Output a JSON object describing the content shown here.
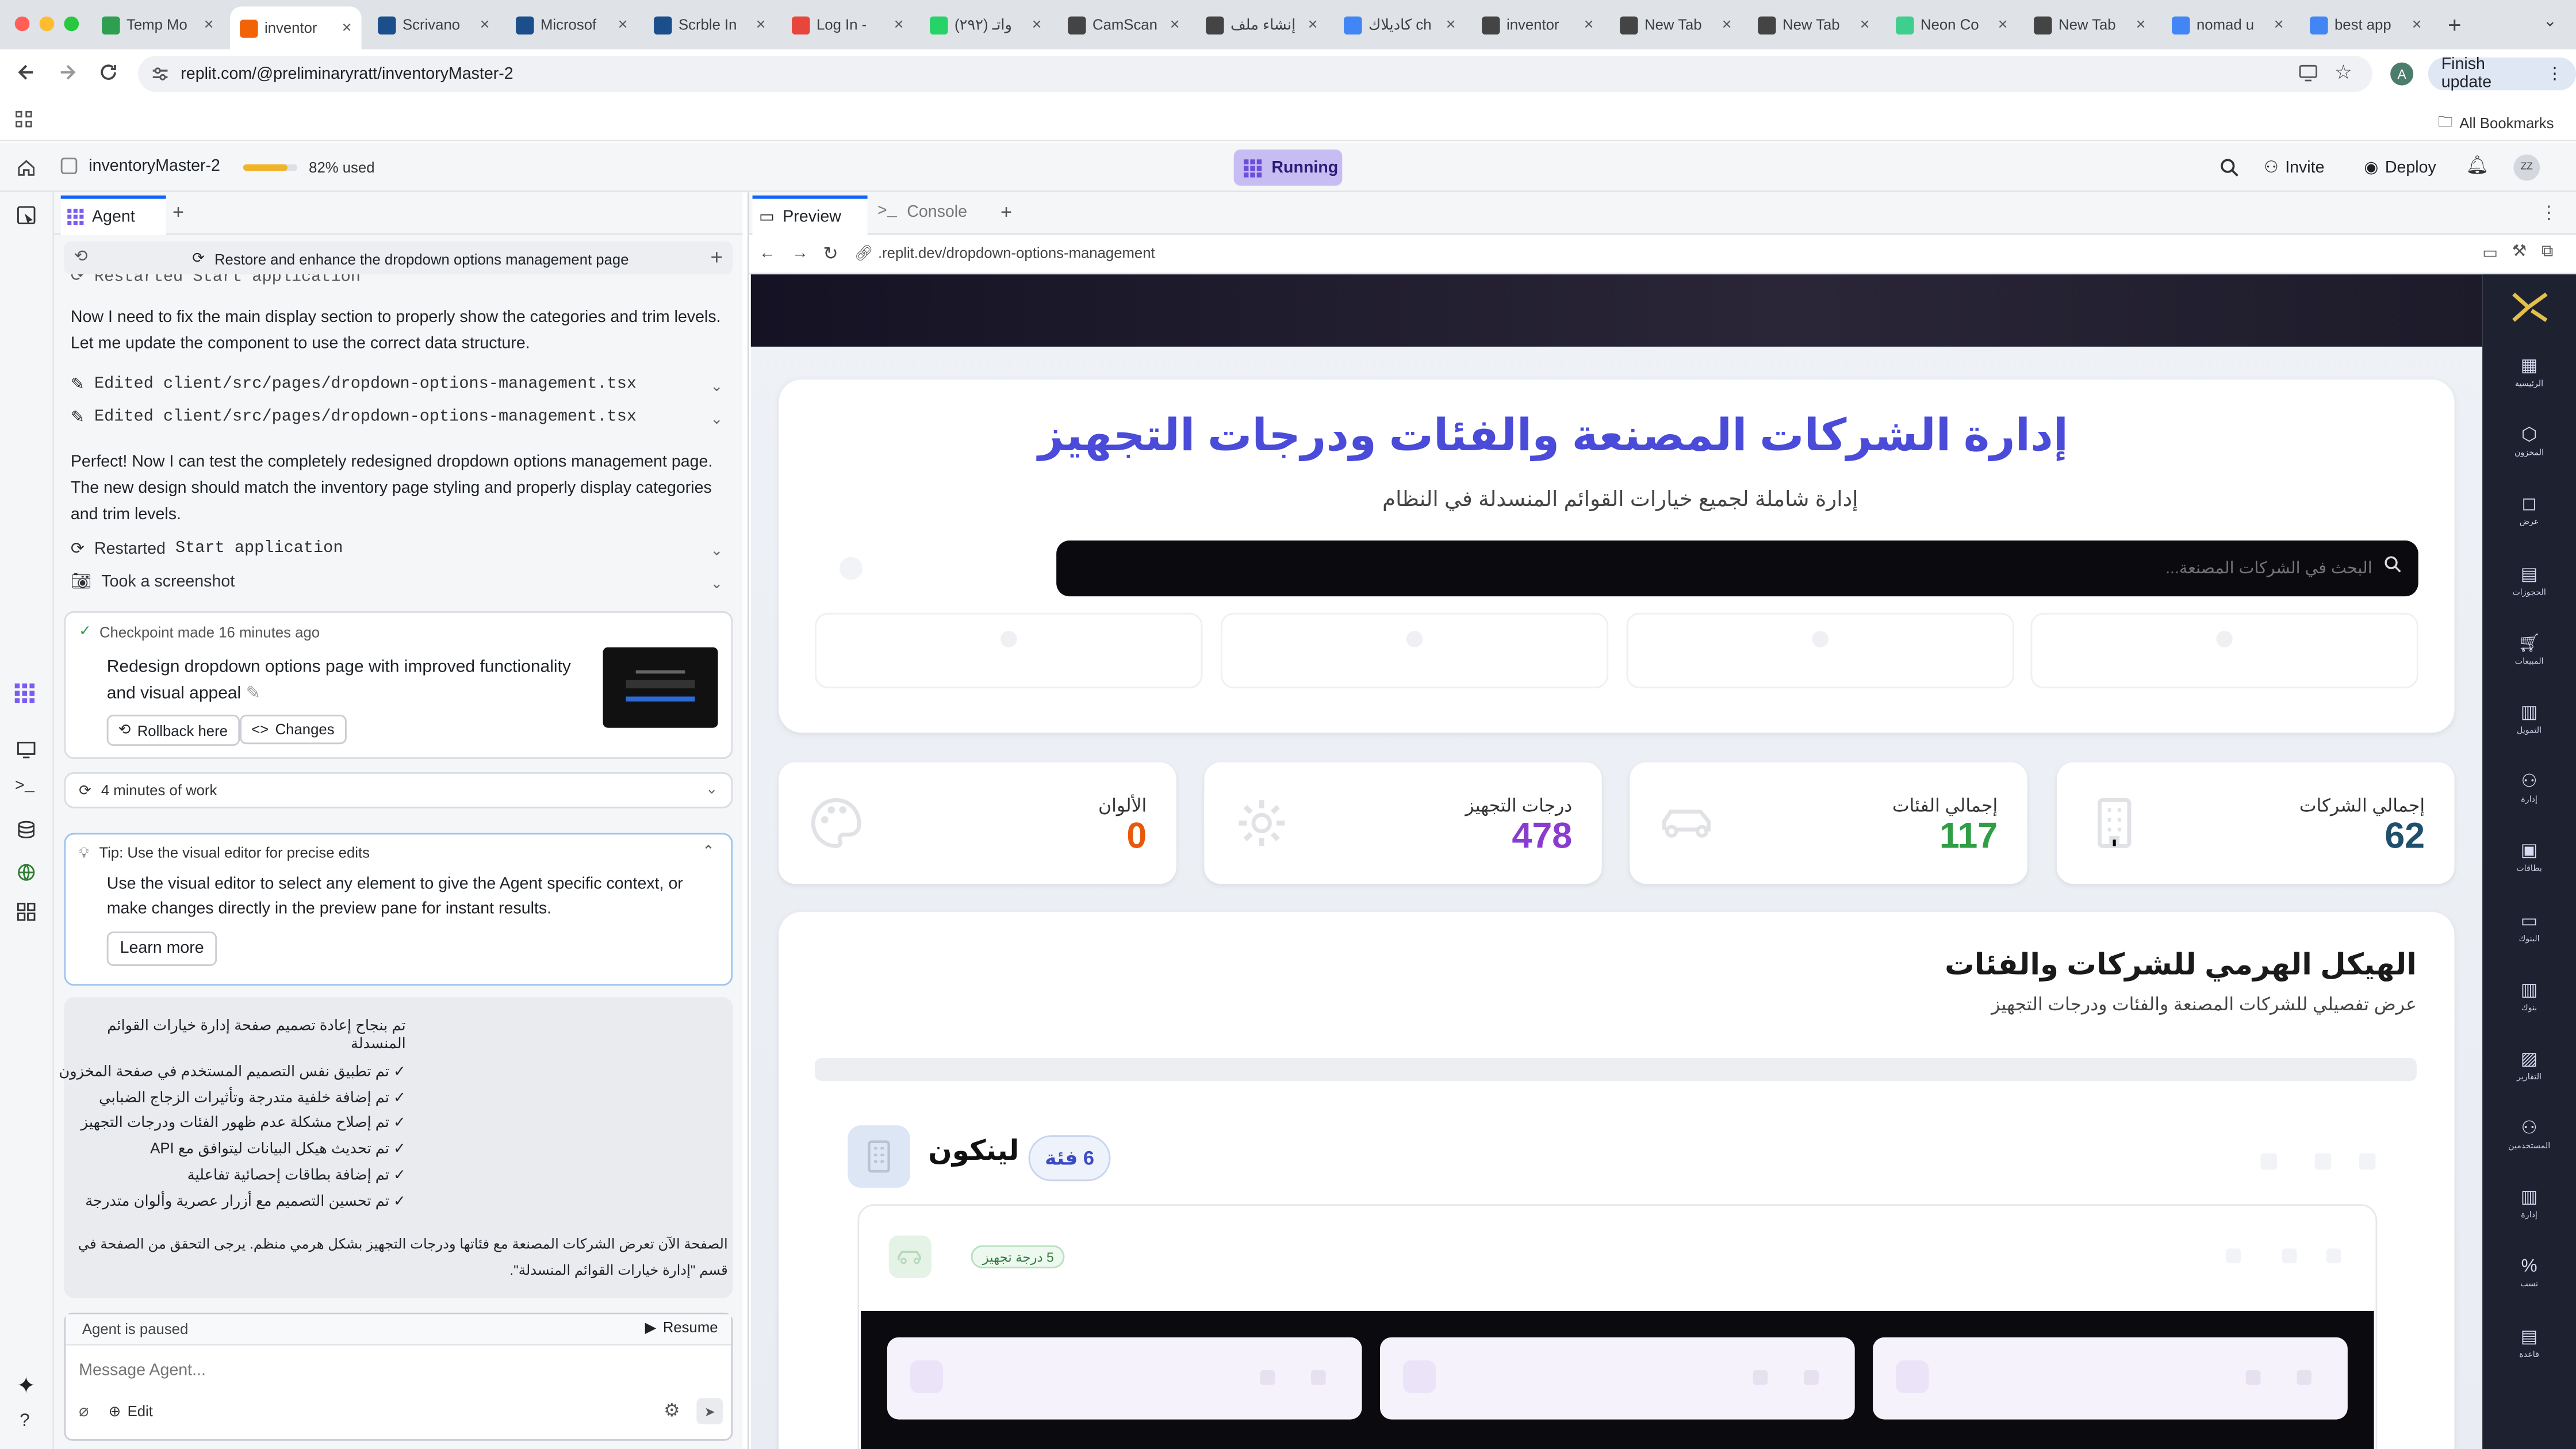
{
  "browser": {
    "tabs": [
      {
        "title": "Temp Mo",
        "color": "#2e9e4f"
      },
      {
        "title": "inventor",
        "color": "#f26207",
        "active": true
      },
      {
        "title": "Scrivano",
        "color": "#1a4f8b"
      },
      {
        "title": "Microsof",
        "color": "#1a4f8b"
      },
      {
        "title": "Scrble In",
        "color": "#1a4f8b"
      },
      {
        "title": "Log In - ",
        "color": "#e8453c"
      },
      {
        "title": "(۲۹۲) واتـ",
        "color": "#25d366"
      },
      {
        "title": "CamScan",
        "color": "#444"
      },
      {
        "title": "إنشاء ملف",
        "color": "#444"
      },
      {
        "title": "كاديلاك ch",
        "color": "#4285f4"
      },
      {
        "title": "inventor",
        "color": "#444"
      },
      {
        "title": "New Tab",
        "color": "#444"
      },
      {
        "title": "New Tab",
        "color": "#444"
      },
      {
        "title": "Neon Co",
        "color": "#3ecf8e"
      },
      {
        "title": "New Tab",
        "color": "#444"
      },
      {
        "title": "nomad u",
        "color": "#4285f4"
      },
      {
        "title": "best app",
        "color": "#4285f4"
      }
    ],
    "url": "replit.com/@preliminaryratt/inventoryMaster-2",
    "finish_update": "Finish update",
    "profile_initial": "A",
    "all_bookmarks": "All Bookmarks"
  },
  "replit": {
    "project": "inventoryMaster-2",
    "usage": "82% used",
    "usage_fraction": 0.82,
    "running": "Running",
    "invite": "Invite",
    "deploy": "Deploy",
    "avatar": "ZZ"
  },
  "agent": {
    "tab": "Agent",
    "thread_title": "Restore and enhance the dropdown options management page",
    "restarted_top": "Restarted Start application",
    "message1": "Now I need to fix the main display section to properly show the categories and trim levels. Let me update the component to use the correct data structure.",
    "edit1": "Edited client/src/pages/dropdown-options-management.tsx",
    "edit2": "Edited client/src/pages/dropdown-options-management.tsx",
    "message2": "Perfect! Now I can test the completely redesigned dropdown options management page. The new design should match the inventory page styling and properly display categories and trim levels.",
    "restarted_label": "Restarted",
    "restarted_code": "Start application",
    "screenshot": "Took a screenshot",
    "checkpoint": {
      "header": "Checkpoint made 16 minutes ago",
      "title": "Redesign dropdown options page with improved functionality and visual appeal",
      "rollback": "Rollback here",
      "changes": "Changes"
    },
    "work": "4 minutes of work",
    "tip": {
      "header": "Tip: Use the visual editor for precise edits",
      "body": "Use the visual editor to select any element to give the Agent specific context, or make changes directly in the preview pane for instant results.",
      "button": "Learn more"
    },
    "summary": {
      "title": "تم بنجاح إعادة تصميم صفحة إدارة خيارات القوائم المنسدلة",
      "items": [
        "✓ تم تطبيق نفس التصميم المستخدم في صفحة المخزون",
        "✓ تم إضافة خلفية متدرجة وتأثيرات الزجاج الضبابي",
        "✓ تم إصلاح مشكلة عدم ظهور الفئات ودرجات التجهيز",
        "✓ تم تحديث هيكل البيانات ليتوافق مع API",
        "✓ تم إضافة بطاقات إحصائية تفاعلية",
        "✓ تم تحسين التصميم مع أزرار عصرية وألوان متدرجة"
      ],
      "footer": "الصفحة الآن تعرض الشركات المصنعة مع فئاتها ودرجات التجهيز بشكل هرمي منظم. يرجى التحقق من الصفحة في قسم \"إدارة خيارات القوائم المنسدلة\"."
    },
    "paused": "Agent is paused",
    "resume": "Resume",
    "input_placeholder": "Message Agent...",
    "edit": "Edit"
  },
  "preview": {
    "tab_preview": "Preview",
    "tab_console": "Console",
    "url": ".replit.dev/dropdown-options-management",
    "app": {
      "title": "إدارة الشركات المصنعة والفئات ودرجات التجهيز",
      "subtitle": "إدارة شاملة لجميع خيارات القوائم المنسدلة في النظام",
      "search_placeholder": "البحث في الشركات المصنعة...",
      "stats": [
        {
          "label": "إجمالي الشركات",
          "value": "62",
          "color": "#1f4f6b"
        },
        {
          "label": "إجمالي الفئات",
          "value": "117",
          "color": "#2f9e44"
        },
        {
          "label": "درجات التجهيز",
          "value": "478",
          "color": "#8a3ccf"
        },
        {
          "label": "الألوان",
          "value": "0",
          "color": "#e8590c"
        }
      ],
      "hierarchy_title": "الهيكل الهرمي للشركات والفئات",
      "hierarchy_subtitle": "عرض تفصيلي للشركات المصنعة والفئات ودرجات التجهيز",
      "maker": "لينكون",
      "maker_badge": "6 فئة",
      "trim_badge": "5 درجة تجهيز",
      "sidebar": [
        "الرئيسية",
        "المخزون",
        "عرض",
        "الحجوزات",
        "المبيعات",
        "التمويل",
        "إدارة",
        "بطاقات",
        "البنوك",
        "بنوك",
        "التقارير",
        "المستخدمين",
        "إدارة",
        "نسب",
        "قاعدة"
      ]
    }
  }
}
